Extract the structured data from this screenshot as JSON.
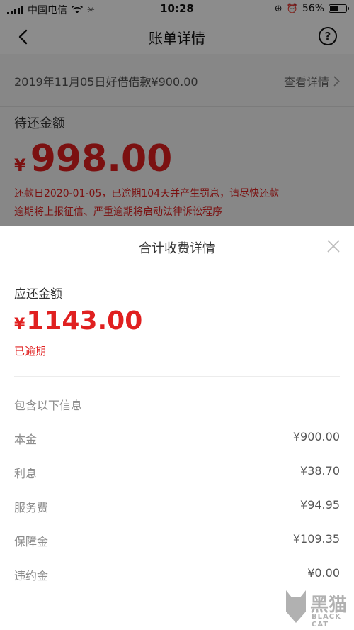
{
  "status_bar": {
    "carrier": "中国电信",
    "time": "10:28",
    "battery": "56%",
    "battery_level": 0.56
  },
  "nav": {
    "title": "账单详情",
    "help": "?"
  },
  "loan": {
    "title": "2019年11月05日好借借款¥900.00",
    "link": "查看详情"
  },
  "pending": {
    "label": "待还金额",
    "currency": "¥",
    "amount": "998.00",
    "warning_line1": "还款日2020-01-05，已逾期104天并产生罚息，请尽快还款",
    "warning_line2": "逾期将上报征信、严重逾期将启动法律诉讼程序"
  },
  "sheet": {
    "title": "合计收费详情",
    "due_label": "应还金额",
    "due_currency": "¥",
    "due_amount": "1143.00",
    "status": "已逾期",
    "info_label": "包含以下信息",
    "items": [
      {
        "name": "本金",
        "value": "¥900.00"
      },
      {
        "name": "利息",
        "value": "¥38.70"
      },
      {
        "name": "服务费",
        "value": "¥94.95"
      },
      {
        "name": "保障金",
        "value": "¥109.35"
      },
      {
        "name": "违约金",
        "value": "¥0.00"
      }
    ]
  },
  "watermark": {
    "text": "黑猫",
    "sub": "BLACK CAT"
  },
  "colors": {
    "accent_red": "#e02020",
    "overlay": "rgba(0,0,0,0.45)"
  }
}
